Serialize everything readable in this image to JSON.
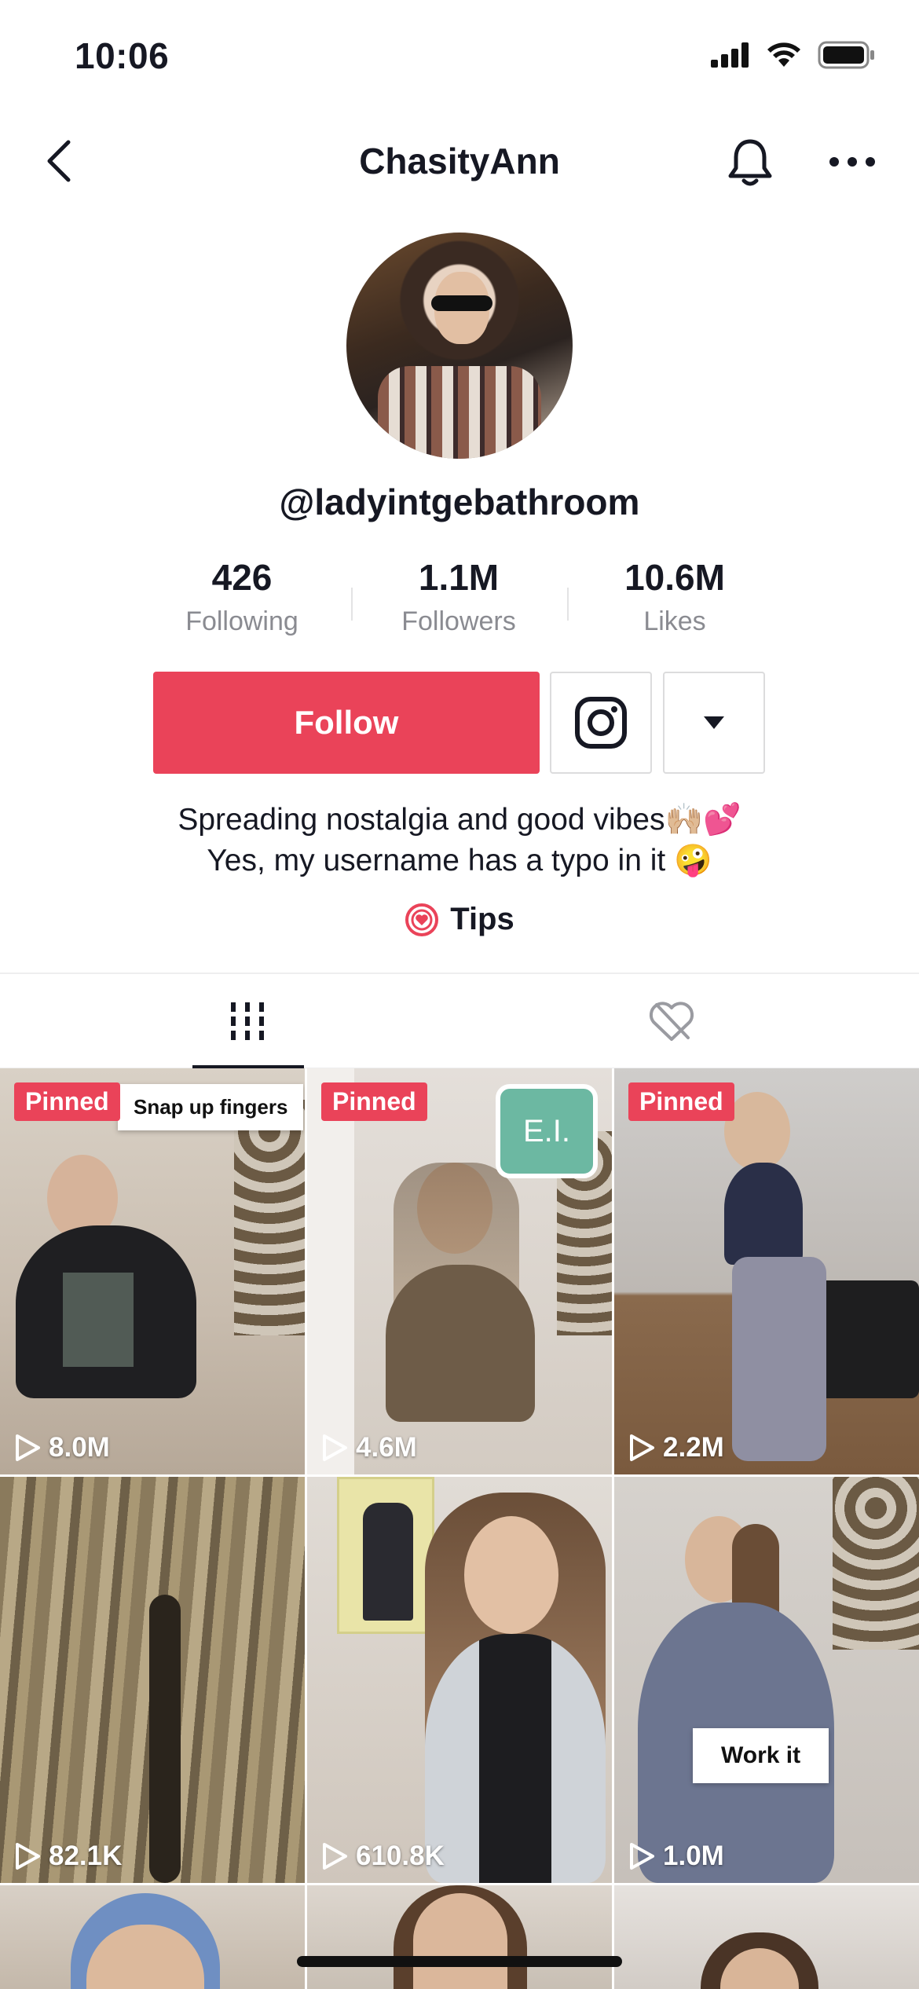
{
  "status_bar": {
    "time": "10:06"
  },
  "nav": {
    "title": "ChasityAnn"
  },
  "profile": {
    "username": "@ladyintgebathroom",
    "stats": [
      {
        "value": "426",
        "label": "Following"
      },
      {
        "value": "1.1M",
        "label": "Followers"
      },
      {
        "value": "10.6M",
        "label": "Likes"
      }
    ],
    "follow_label": "Follow",
    "bio_line1": "Spreading nostalgia and good vibes🙌🏼💕",
    "bio_line2": "Yes, my username has a typo in it 🤪",
    "tips_label": "Tips"
  },
  "videos": [
    {
      "pinned": "Pinned",
      "views": "8.0M",
      "sticker": "Snap up fingers"
    },
    {
      "pinned": "Pinned",
      "views": "4.6M",
      "sticker": "E.I."
    },
    {
      "pinned": "Pinned",
      "views": "2.2M"
    },
    {
      "views": "82.1K"
    },
    {
      "views": "610.8K"
    },
    {
      "views": "1.0M",
      "sticker": "Work it"
    }
  ],
  "colors": {
    "accent": "#ea4359",
    "text": "#161823",
    "muted": "#8a8b91"
  }
}
